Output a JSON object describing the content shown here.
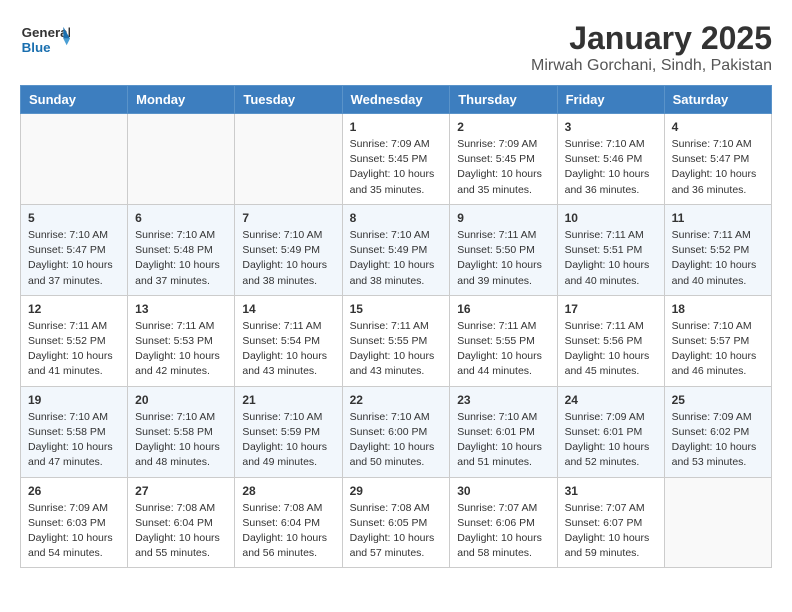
{
  "header": {
    "logo_general": "General",
    "logo_blue": "Blue",
    "title": "January 2025",
    "location": "Mirwah Gorchani, Sindh, Pakistan"
  },
  "weekdays": [
    "Sunday",
    "Monday",
    "Tuesday",
    "Wednesday",
    "Thursday",
    "Friday",
    "Saturday"
  ],
  "weeks": [
    [
      {
        "day": "",
        "info": ""
      },
      {
        "day": "",
        "info": ""
      },
      {
        "day": "",
        "info": ""
      },
      {
        "day": "1",
        "info": "Sunrise: 7:09 AM\nSunset: 5:45 PM\nDaylight: 10 hours\nand 35 minutes."
      },
      {
        "day": "2",
        "info": "Sunrise: 7:09 AM\nSunset: 5:45 PM\nDaylight: 10 hours\nand 35 minutes."
      },
      {
        "day": "3",
        "info": "Sunrise: 7:10 AM\nSunset: 5:46 PM\nDaylight: 10 hours\nand 36 minutes."
      },
      {
        "day": "4",
        "info": "Sunrise: 7:10 AM\nSunset: 5:47 PM\nDaylight: 10 hours\nand 36 minutes."
      }
    ],
    [
      {
        "day": "5",
        "info": "Sunrise: 7:10 AM\nSunset: 5:47 PM\nDaylight: 10 hours\nand 37 minutes."
      },
      {
        "day": "6",
        "info": "Sunrise: 7:10 AM\nSunset: 5:48 PM\nDaylight: 10 hours\nand 37 minutes."
      },
      {
        "day": "7",
        "info": "Sunrise: 7:10 AM\nSunset: 5:49 PM\nDaylight: 10 hours\nand 38 minutes."
      },
      {
        "day": "8",
        "info": "Sunrise: 7:10 AM\nSunset: 5:49 PM\nDaylight: 10 hours\nand 38 minutes."
      },
      {
        "day": "9",
        "info": "Sunrise: 7:11 AM\nSunset: 5:50 PM\nDaylight: 10 hours\nand 39 minutes."
      },
      {
        "day": "10",
        "info": "Sunrise: 7:11 AM\nSunset: 5:51 PM\nDaylight: 10 hours\nand 40 minutes."
      },
      {
        "day": "11",
        "info": "Sunrise: 7:11 AM\nSunset: 5:52 PM\nDaylight: 10 hours\nand 40 minutes."
      }
    ],
    [
      {
        "day": "12",
        "info": "Sunrise: 7:11 AM\nSunset: 5:52 PM\nDaylight: 10 hours\nand 41 minutes."
      },
      {
        "day": "13",
        "info": "Sunrise: 7:11 AM\nSunset: 5:53 PM\nDaylight: 10 hours\nand 42 minutes."
      },
      {
        "day": "14",
        "info": "Sunrise: 7:11 AM\nSunset: 5:54 PM\nDaylight: 10 hours\nand 43 minutes."
      },
      {
        "day": "15",
        "info": "Sunrise: 7:11 AM\nSunset: 5:55 PM\nDaylight: 10 hours\nand 43 minutes."
      },
      {
        "day": "16",
        "info": "Sunrise: 7:11 AM\nSunset: 5:55 PM\nDaylight: 10 hours\nand 44 minutes."
      },
      {
        "day": "17",
        "info": "Sunrise: 7:11 AM\nSunset: 5:56 PM\nDaylight: 10 hours\nand 45 minutes."
      },
      {
        "day": "18",
        "info": "Sunrise: 7:10 AM\nSunset: 5:57 PM\nDaylight: 10 hours\nand 46 minutes."
      }
    ],
    [
      {
        "day": "19",
        "info": "Sunrise: 7:10 AM\nSunset: 5:58 PM\nDaylight: 10 hours\nand 47 minutes."
      },
      {
        "day": "20",
        "info": "Sunrise: 7:10 AM\nSunset: 5:58 PM\nDaylight: 10 hours\nand 48 minutes."
      },
      {
        "day": "21",
        "info": "Sunrise: 7:10 AM\nSunset: 5:59 PM\nDaylight: 10 hours\nand 49 minutes."
      },
      {
        "day": "22",
        "info": "Sunrise: 7:10 AM\nSunset: 6:00 PM\nDaylight: 10 hours\nand 50 minutes."
      },
      {
        "day": "23",
        "info": "Sunrise: 7:10 AM\nSunset: 6:01 PM\nDaylight: 10 hours\nand 51 minutes."
      },
      {
        "day": "24",
        "info": "Sunrise: 7:09 AM\nSunset: 6:01 PM\nDaylight: 10 hours\nand 52 minutes."
      },
      {
        "day": "25",
        "info": "Sunrise: 7:09 AM\nSunset: 6:02 PM\nDaylight: 10 hours\nand 53 minutes."
      }
    ],
    [
      {
        "day": "26",
        "info": "Sunrise: 7:09 AM\nSunset: 6:03 PM\nDaylight: 10 hours\nand 54 minutes."
      },
      {
        "day": "27",
        "info": "Sunrise: 7:08 AM\nSunset: 6:04 PM\nDaylight: 10 hours\nand 55 minutes."
      },
      {
        "day": "28",
        "info": "Sunrise: 7:08 AM\nSunset: 6:04 PM\nDaylight: 10 hours\nand 56 minutes."
      },
      {
        "day": "29",
        "info": "Sunrise: 7:08 AM\nSunset: 6:05 PM\nDaylight: 10 hours\nand 57 minutes."
      },
      {
        "day": "30",
        "info": "Sunrise: 7:07 AM\nSunset: 6:06 PM\nDaylight: 10 hours\nand 58 minutes."
      },
      {
        "day": "31",
        "info": "Sunrise: 7:07 AM\nSunset: 6:07 PM\nDaylight: 10 hours\nand 59 minutes."
      },
      {
        "day": "",
        "info": ""
      }
    ]
  ]
}
